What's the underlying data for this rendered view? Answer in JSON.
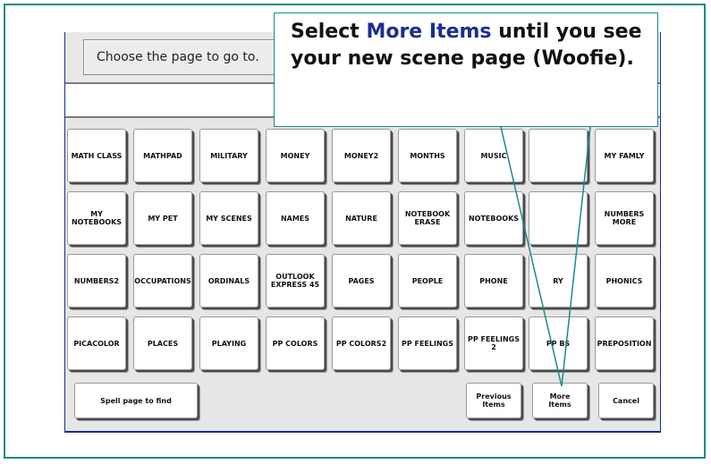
{
  "dialog": {
    "prompt": "Choose the page to go to.",
    "input_value": ""
  },
  "pages": [
    [
      "MATH CLASS",
      "MATHPAD",
      "MILITARY",
      "MONEY",
      "MONEY2",
      "MONTHS",
      "MUSIC",
      "",
      "MY FAMLY"
    ],
    [
      "MY\nNOTEBOOKS",
      "MY PET",
      "MY SCENES",
      "NAMES",
      "NATURE",
      "NOTEBOOK\nERASE",
      "NOTEBOOKS",
      "",
      "NUMBERS\nMORE"
    ],
    [
      "NUMBERS2",
      "OCCUPATIONS",
      "ORDINALS",
      "OUTLOOK\nEXPRESS 45",
      "PAGES",
      "PEOPLE",
      "PHONE",
      "RY",
      "PHONICS"
    ],
    [
      "PICACOLOR",
      "PLACES",
      "PLAYING",
      "PP COLORS",
      "PP COLORS2",
      "PP FEELINGS",
      "PP FEELINGS\n2",
      "PP      BS",
      "PREPOSITION"
    ]
  ],
  "bottom": {
    "spell": "Spell page to find",
    "previous": "Previous\nItems",
    "more": "More\nItems",
    "cancel": "Cancel"
  },
  "callout": {
    "text_before": "Select ",
    "highlight": "More Items",
    "text_after": " until you see your new scene page (Woofie)."
  },
  "colors": {
    "frame": "#1a8a85",
    "highlight": "#1c2d8f"
  }
}
